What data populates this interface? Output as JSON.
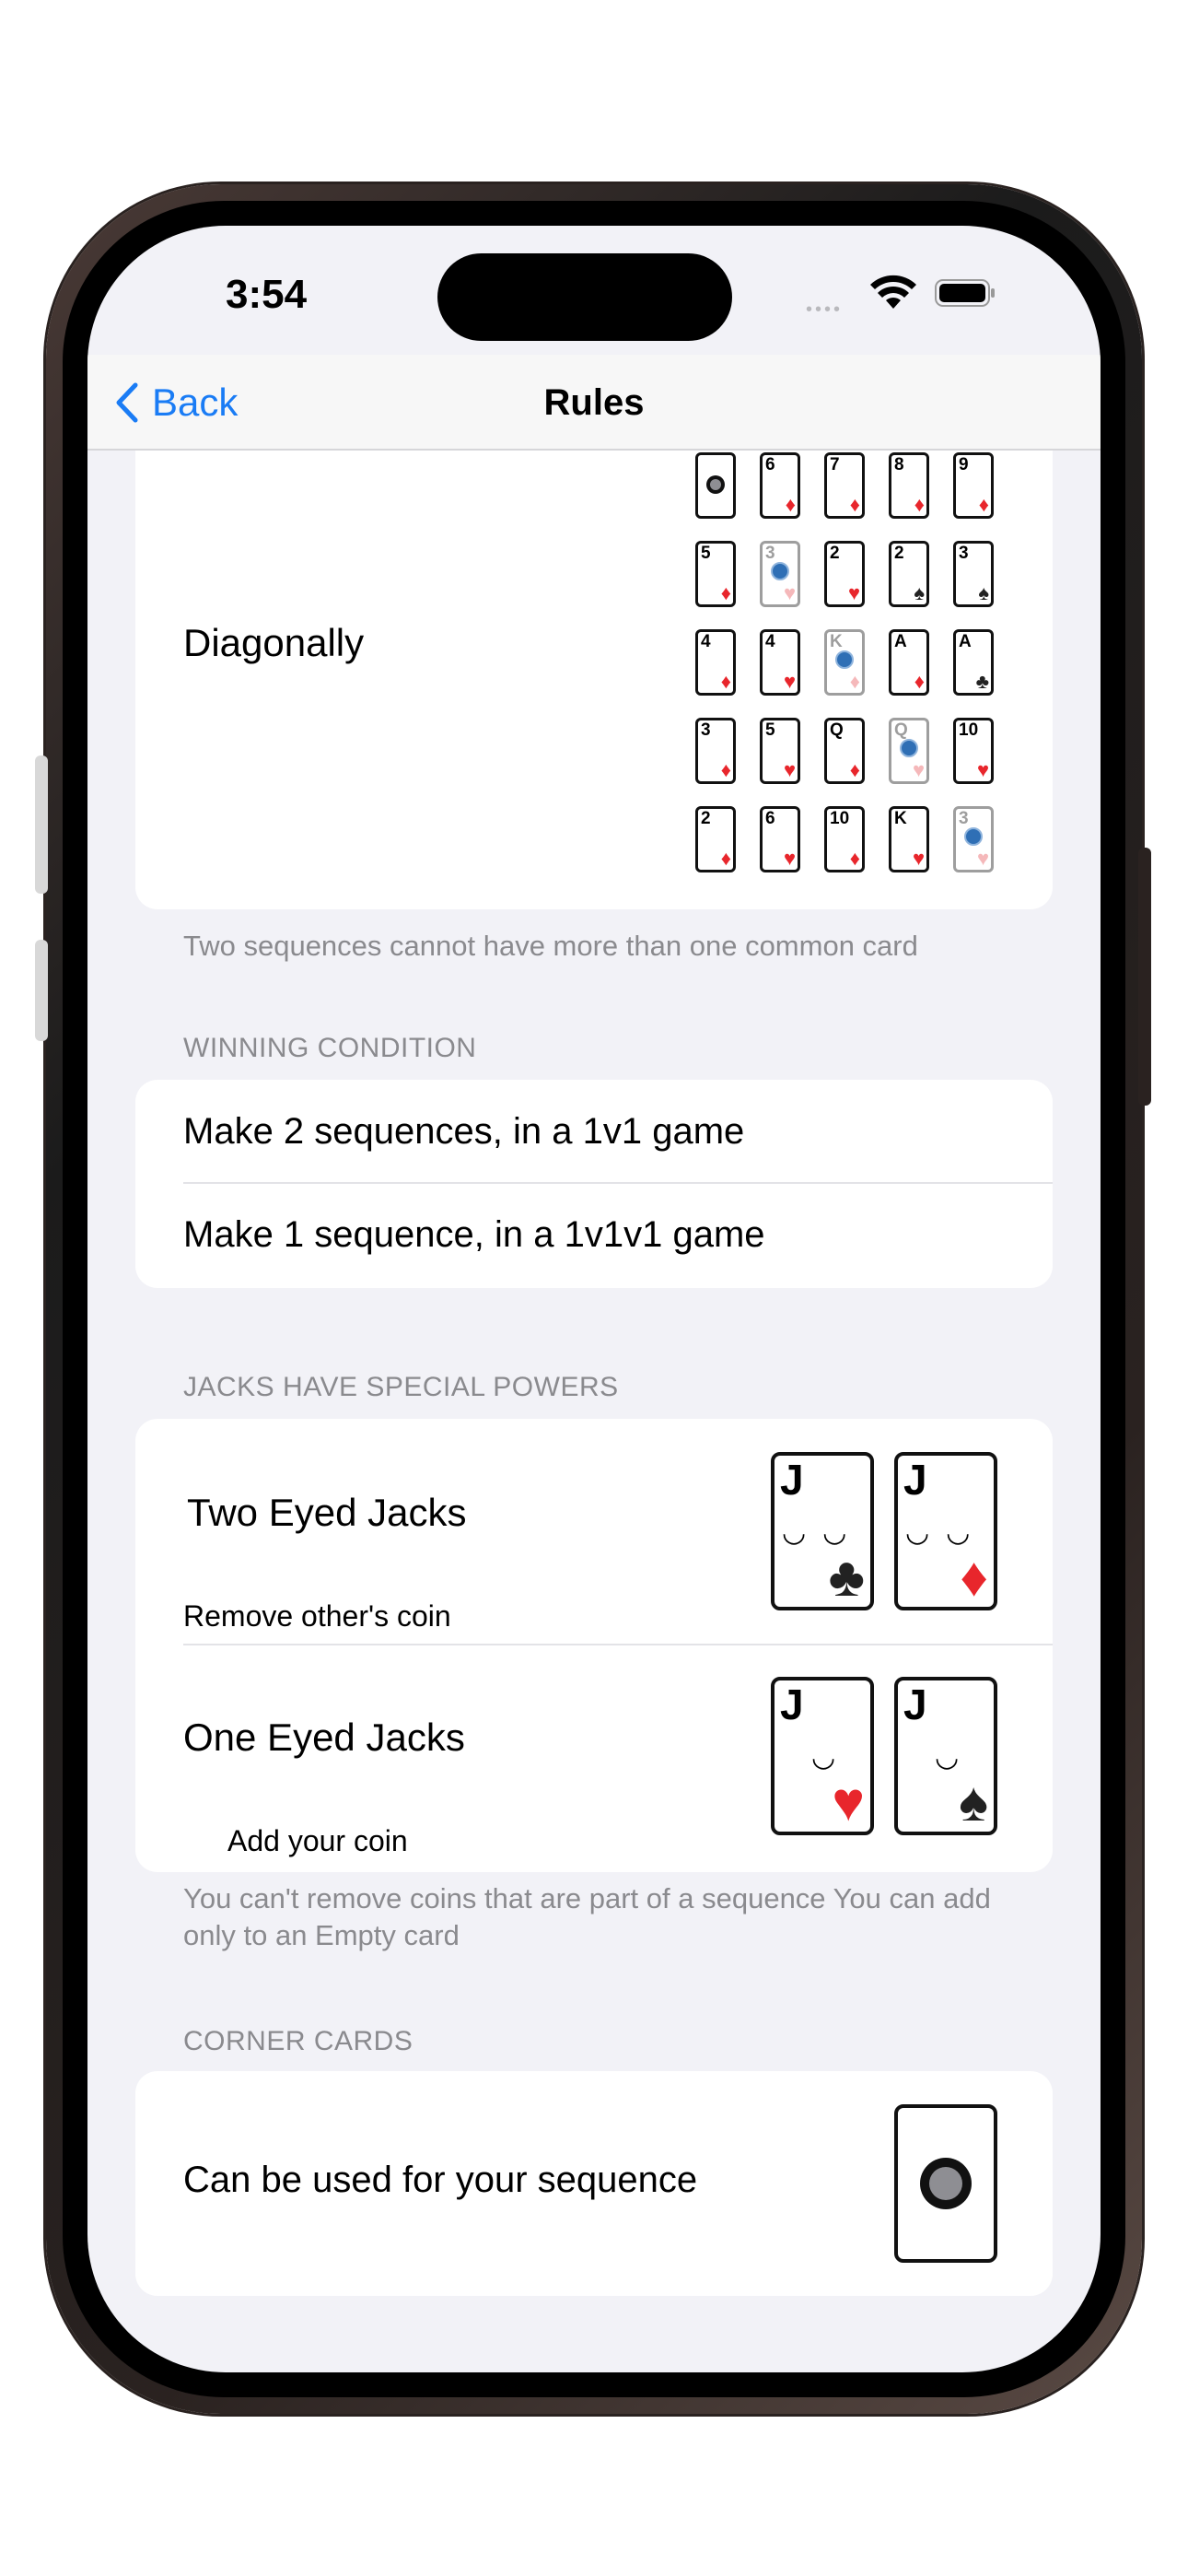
{
  "status_bar": {
    "time": "3:54",
    "dots": "••••"
  },
  "nav": {
    "back_label": "Back",
    "title": "Rules"
  },
  "diagonal": {
    "label": "Diagonally",
    "grid": [
      [
        {
          "rank": "",
          "suit": "coin"
        },
        {
          "rank": "6",
          "suit": "♦"
        },
        {
          "rank": "7",
          "suit": "♦"
        },
        {
          "rank": "8",
          "suit": "♦"
        },
        {
          "rank": "9",
          "suit": "♦"
        }
      ],
      [
        {
          "rank": "5",
          "suit": "♦"
        },
        {
          "rank": "3",
          "suit": "♥",
          "coin": true
        },
        {
          "rank": "2",
          "suit": "♥"
        },
        {
          "rank": "2",
          "suit": "♠"
        },
        {
          "rank": "3",
          "suit": "♠"
        }
      ],
      [
        {
          "rank": "4",
          "suit": "♦"
        },
        {
          "rank": "4",
          "suit": "♥"
        },
        {
          "rank": "K",
          "suit": "♦",
          "coin": true
        },
        {
          "rank": "A",
          "suit": "♦"
        },
        {
          "rank": "A",
          "suit": "♣"
        }
      ],
      [
        {
          "rank": "3",
          "suit": "♦"
        },
        {
          "rank": "5",
          "suit": "♥"
        },
        {
          "rank": "Q",
          "suit": "♦"
        },
        {
          "rank": "Q",
          "suit": "♥",
          "coin": true
        },
        {
          "rank": "10",
          "suit": "♥"
        }
      ],
      [
        {
          "rank": "2",
          "suit": "♦"
        },
        {
          "rank": "6",
          "suit": "♥"
        },
        {
          "rank": "10",
          "suit": "♦"
        },
        {
          "rank": "K",
          "suit": "♥"
        },
        {
          "rank": "3",
          "suit": "♥",
          "coin": true
        }
      ]
    ],
    "footer": "Two sequences cannot have more than one common card"
  },
  "winning": {
    "header": "WINNING CONDITION",
    "rows": [
      "Make 2 sequences, in a 1v1 game",
      "Make 1 sequence, in a 1v1v1 game"
    ]
  },
  "jacks": {
    "header": "JACKS HAVE SPECIAL POWERS",
    "two_eyed": {
      "title": "Two Eyed Jacks",
      "subtitle": "Remove other's coin",
      "cards": [
        {
          "rank": "J",
          "suit": "♣"
        },
        {
          "rank": "J",
          "suit": "♦"
        }
      ]
    },
    "one_eyed": {
      "title": "One Eyed Jacks",
      "subtitle": "Add your coin",
      "cards": [
        {
          "rank": "J",
          "suit": "♥"
        },
        {
          "rank": "J",
          "suit": "♠"
        }
      ]
    },
    "footer": "You can't remove coins that are part of a sequence You can add only to an Empty card"
  },
  "corner": {
    "header": "CORNER CARDS",
    "row": "Can be used for your sequence"
  },
  "colors": {
    "accent": "#1a7cf5",
    "red_suit": "#e8262c",
    "background": "#f2f2f7"
  }
}
